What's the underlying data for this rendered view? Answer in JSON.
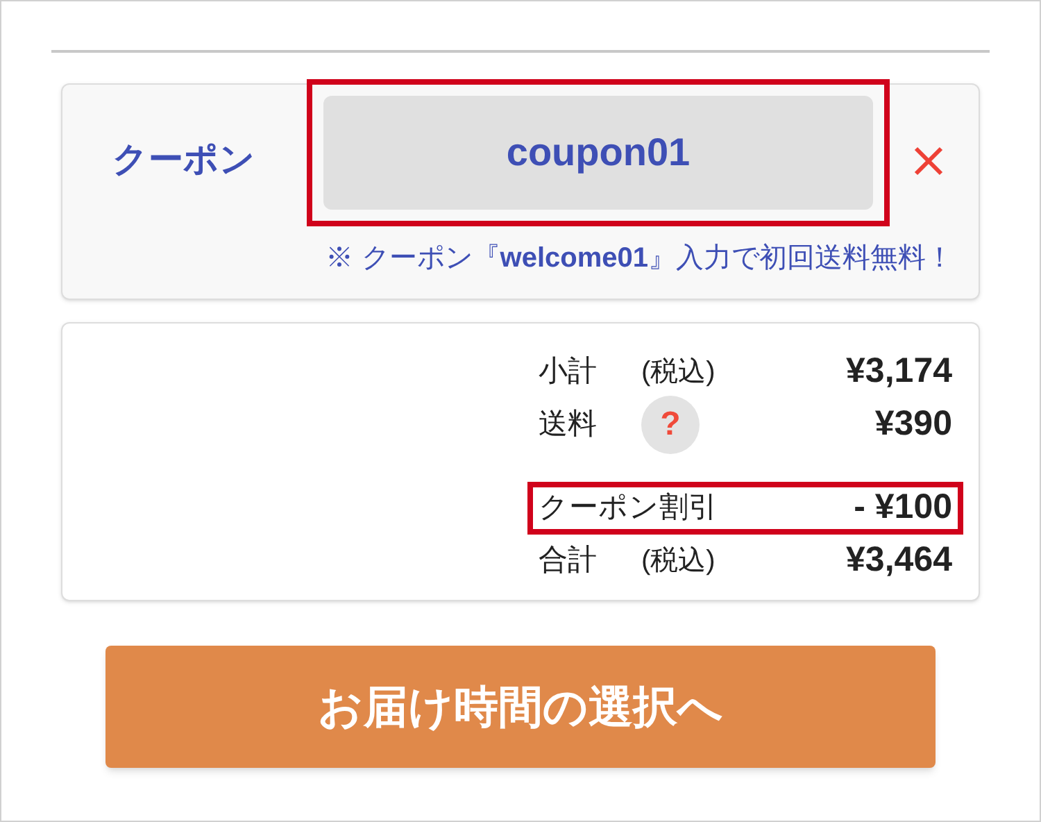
{
  "coupon": {
    "label": "クーポン",
    "value": "coupon01",
    "highlighted": true,
    "note": "※ クーポン『**welcome01**』入力で初回送料無料！"
  },
  "summary": [
    {
      "kind": "plain",
      "label": "小計",
      "note": "(税込)",
      "amount": "¥3,174",
      "highlighted": false
    },
    {
      "kind": "help",
      "label": "送料",
      "help": "?",
      "amount": "¥390",
      "highlighted": false
    },
    {
      "kind": "plain",
      "label": "クーポン割引",
      "amount": "- ¥100",
      "highlighted": true
    },
    {
      "kind": "plain",
      "label": "合計",
      "note": "(税込)",
      "amount": "¥3,464",
      "highlighted": false
    }
  ],
  "button": "お届け時間の選択へ"
}
